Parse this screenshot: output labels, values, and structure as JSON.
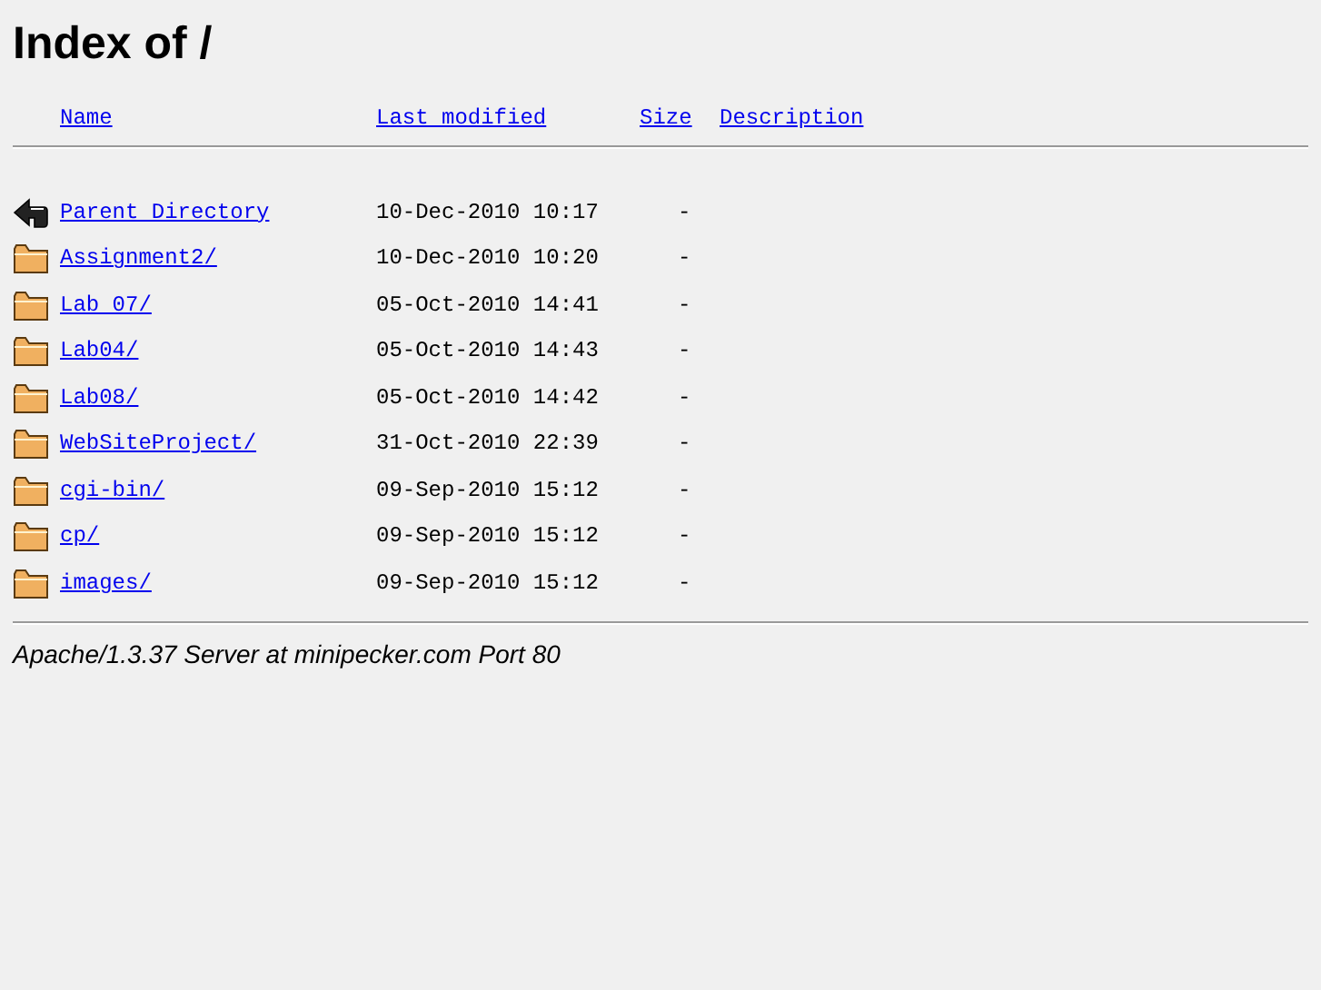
{
  "title": "Index of /",
  "columns": [
    "Name",
    "Last modified",
    "Size",
    "Description"
  ],
  "rows": [
    {
      "kind": "parent",
      "name": "Parent Directory",
      "modified": "10-Dec-2010 10:17",
      "size": "-"
    },
    {
      "kind": "folder",
      "name": "Assignment2/",
      "modified": "10-Dec-2010 10:20",
      "size": "-"
    },
    {
      "kind": "folder",
      "name": "Lab 07/",
      "modified": "05-Oct-2010 14:41",
      "size": "-"
    },
    {
      "kind": "folder",
      "name": "Lab04/",
      "modified": "05-Oct-2010 14:43",
      "size": "-"
    },
    {
      "kind": "folder",
      "name": "Lab08/",
      "modified": "05-Oct-2010 14:42",
      "size": "-"
    },
    {
      "kind": "folder",
      "name": "WebSiteProject/",
      "modified": "31-Oct-2010 22:39",
      "size": "-"
    },
    {
      "kind": "folder",
      "name": "cgi-bin/",
      "modified": "09-Sep-2010 15:12",
      "size": "-"
    },
    {
      "kind": "folder",
      "name": "cp/",
      "modified": "09-Sep-2010 15:12",
      "size": "-"
    },
    {
      "kind": "folder",
      "name": "images/",
      "modified": "09-Sep-2010 15:12",
      "size": "-"
    }
  ],
  "footer": "Apache/1.3.37 Server at minipecker.com Port 80"
}
